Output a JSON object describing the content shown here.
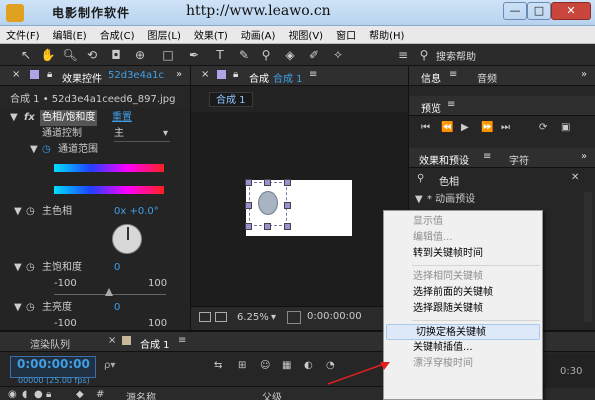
{
  "titlebar": {
    "logo": "电影制作软件",
    "url": "http://www.leawo.cn",
    "minimize": "—",
    "maximize": "□",
    "close": "✕"
  },
  "menu": [
    "文件(F)",
    "编辑(E)",
    "合成(C)",
    "图层(L)",
    "效果(T)",
    "动画(A)",
    "视图(V)",
    "窗口",
    "帮助(H)"
  ],
  "toolbar": {
    "search_placeholder": "搜索帮助"
  },
  "effects_panel": {
    "tab": "效果控件",
    "tab_file": "52d3e4a1c",
    "breadcrumb": "合成 1 • 52d3e4a1ceed6_897.jpg",
    "effect_name": "色相/饱和度",
    "reset": "重置",
    "channel_label": "通道控制",
    "channel_value": "主",
    "range_label": "通道范围",
    "hue_label": "主色相",
    "hue_value": "0x +0.0°",
    "sat_label": "主饱和度",
    "sat_value": "0",
    "sat_min": "-100",
    "sat_max": "100",
    "light_label": "主亮度",
    "light_value": "0",
    "light_min": "-100",
    "light_max": "100"
  },
  "comp_panel": {
    "tab": "合成",
    "tab_name": "合成 1",
    "subtab": "合成 1",
    "zoom": "6.25%",
    "timecode": "0:00:00:00"
  },
  "right_panel": {
    "info_tab": "信息",
    "audio_tab": "音频",
    "preview_tab": "预览",
    "effects_tab": "效果和预设",
    "char_tab": "字符",
    "search_value": "色相",
    "tree_item": "* 动画预设"
  },
  "bottom_panel": {
    "render_tab": "渲染队列",
    "comp_tab": "合成 1",
    "timecode": "0:00:00:00",
    "fps": "00000 (25.00 fps)",
    "col_source": "源名称",
    "col_parent": "父级",
    "time_end": "0:30",
    "search_placeholder": "ρ▾"
  },
  "context_menu": {
    "items": [
      {
        "label": "显示值",
        "disabled": true
      },
      {
        "label": "编辑值...",
        "disabled": true
      },
      {
        "label": "转到关键帧时间",
        "disabled": false
      },
      {
        "sep": true
      },
      {
        "label": "选择相同关键帧",
        "disabled": true
      },
      {
        "label": "选择前面的关键帧",
        "disabled": false
      },
      {
        "label": "选择跟随关键帧",
        "disabled": false
      },
      {
        "sep": true
      },
      {
        "label": "切换定格关键帧",
        "disabled": false,
        "highlight": true
      },
      {
        "label": "关键帧插值...",
        "disabled": false
      },
      {
        "label": "漂浮穿梭时间",
        "disabled": true
      }
    ]
  }
}
